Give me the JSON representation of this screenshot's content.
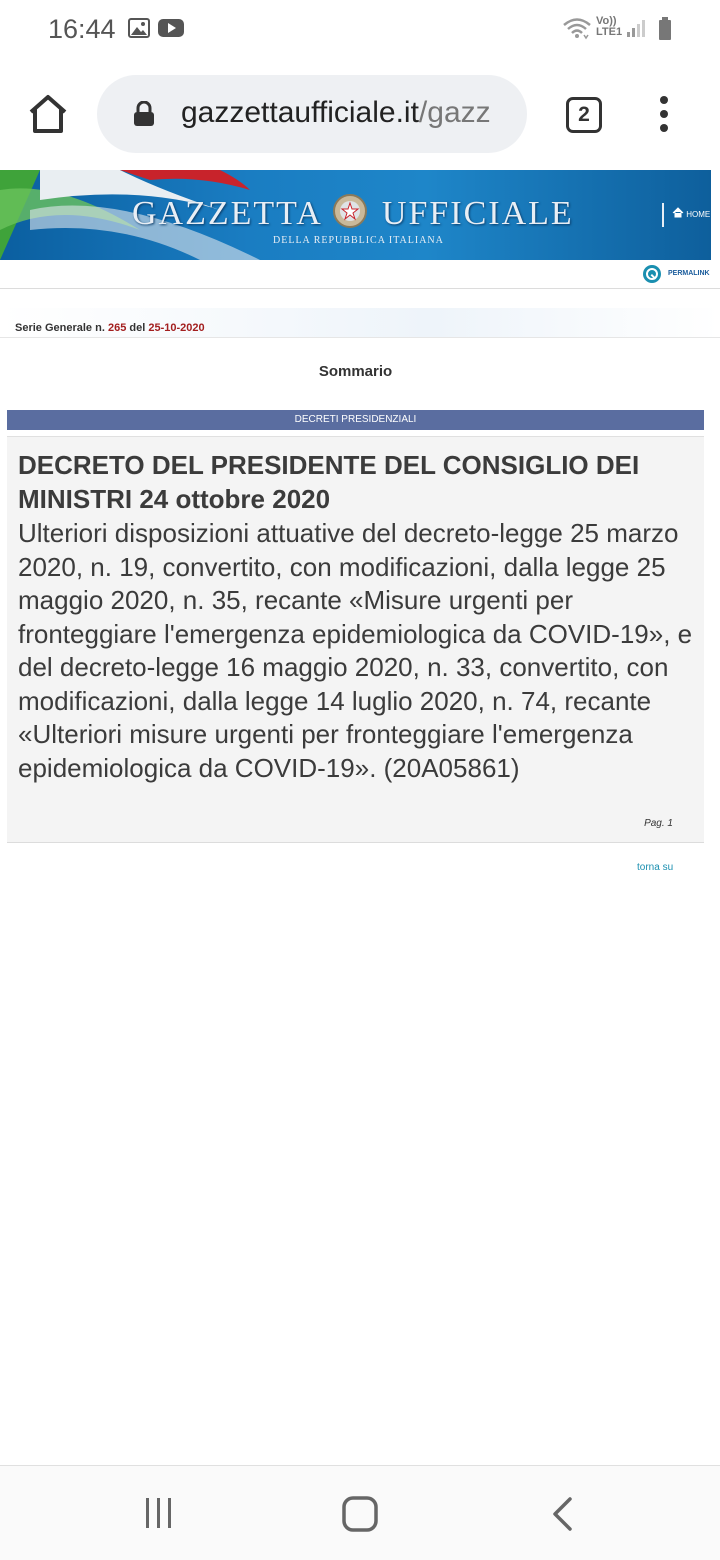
{
  "status_bar": {
    "time": "16:44",
    "icons_left": [
      "image-icon",
      "youtube-icon"
    ],
    "icons_right": [
      "wifi-icon",
      "volte-icon",
      "signal-icon",
      "battery-icon"
    ],
    "volte_label_top": "Vo))",
    "volte_label_bottom": "LTE1"
  },
  "browser": {
    "url_domain": "gazzettaufficiale.it",
    "url_path": "/gazz",
    "tab_count": "2"
  },
  "banner": {
    "title_left": "GAZZETTA",
    "title_right": "UFFICIALE",
    "subtitle": "DELLA REPUBBLICA ITALIANA",
    "home_label": "HOME",
    "permalink_label": "PERMALINK"
  },
  "serie": {
    "prefix": "Serie Generale n.",
    "number": "265",
    "del_label": "del",
    "date": "25-10-2020"
  },
  "content": {
    "sommario": "Sommario",
    "section": "DECRETI PRESIDENZIALI",
    "entry_title": "DECRETO DEL PRESIDENTE DEL CONSIGLIO DEI MINISTRI 24 ottobre 2020",
    "entry_body": "Ulteriori disposizioni attuative del decreto-legge 25 marzo 2020, n. 19, convertito, con modificazioni, dalla legge 25 maggio 2020, n. 35, recante «Misure urgenti per fronteggiare l'emergenza epidemiologica da COVID-19», e del decreto-legge 16 maggio 2020, n. 33, convertito, con modificazioni, dalla legge 14 luglio 2020, n. 74, recante «Ulteriori misure urgenti per fronteggiare l'emergenza epidemiologica da COVID-19». (20A05861)",
    "entry_page": "Pag. 1",
    "torna_su": "torna su"
  },
  "colors": {
    "section_bar": "#5a6da0",
    "serie_red": "#a31f1f",
    "link": "#1a8fb0"
  }
}
